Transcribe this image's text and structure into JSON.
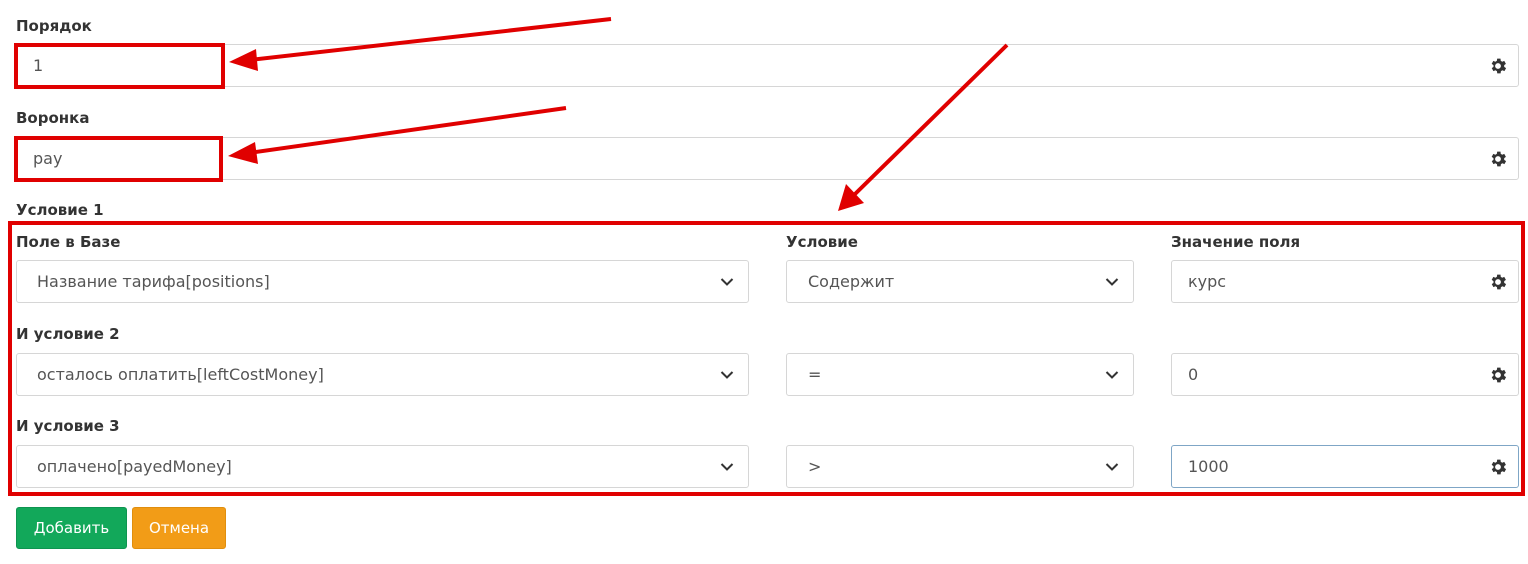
{
  "order": {
    "label": "Порядок",
    "value": "1",
    "settings_icon": "gear-icon"
  },
  "funnel": {
    "label": "Воронка",
    "value": "pay",
    "settings_icon": "gear-icon"
  },
  "condition_1_heading": "Условие 1",
  "columns": {
    "field": "Поле в Базе",
    "condition": "Условие",
    "value": "Значение поля"
  },
  "conditions": [
    {
      "field": "Название тарифа[positions]",
      "operator": "Содержит",
      "value": "курс"
    },
    {
      "label": "И условие 2",
      "field": "осталось оплатить[leftCostMoney]",
      "operator": "=",
      "value": "0"
    },
    {
      "label": "И условие 3",
      "field": "оплачено[payedMoney]",
      "operator": ">",
      "value": "1000"
    }
  ],
  "buttons": {
    "add": "Добавить",
    "cancel": "Отмена"
  },
  "colors": {
    "add_button": "#12a85a",
    "cancel_button": "#f29c17",
    "annotation_red": "#e00000"
  },
  "icons": {
    "select": "chevron-down-icon",
    "settings": "gear-icon"
  }
}
